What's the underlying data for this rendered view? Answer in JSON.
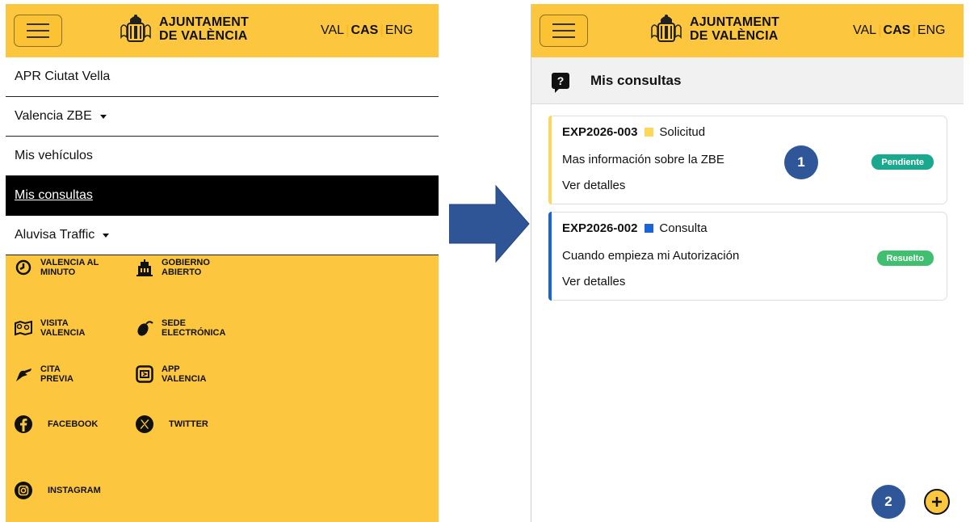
{
  "brand": {
    "line1": "AJUNTAMENT",
    "line2": "DE VALÈNCIA",
    "accent_color": "#fdc63f"
  },
  "languages": {
    "val": "VAL",
    "cas": "CAS",
    "eng": "ENG",
    "separator": "|",
    "selected": "CAS"
  },
  "menu": {
    "items": [
      {
        "label": "APR Ciutat Vella",
        "dropdown": false,
        "active": false
      },
      {
        "label": "Valencia ZBE",
        "dropdown": true,
        "active": false
      },
      {
        "label": "Mis vehículos",
        "dropdown": false,
        "active": false
      },
      {
        "label": "Mis consultas",
        "dropdown": false,
        "active": true
      },
      {
        "label": "Aluvisa Traffic",
        "dropdown": true,
        "active": false
      }
    ]
  },
  "footer_links": [
    {
      "label1": "VALENCIA AL",
      "label2": "MINUTO",
      "icon": "clock-icon"
    },
    {
      "label1": "GOBIERNO",
      "label2": "ABIERTO",
      "icon": "building-icon"
    },
    {
      "label1": "VISITA",
      "label2": "VALENCIA",
      "icon": "map-icon"
    },
    {
      "label1": "SEDE",
      "label2": "ELECTRÓNICA",
      "icon": "mouse-icon"
    },
    {
      "label1": "CITA",
      "label2": "PREVIA",
      "icon": "hand-icon"
    },
    {
      "label1": "APP",
      "label2": "VALENCIA",
      "icon": "app-icon"
    },
    {
      "label1": "FACEBOOK",
      "label2": "",
      "icon": "facebook-icon"
    },
    {
      "label1": "TWITTER",
      "label2": "",
      "icon": "x-twitter-icon"
    },
    {
      "label1": "INSTAGRAM",
      "label2": "",
      "icon": "instagram-icon"
    }
  ],
  "consultas": {
    "title": "Mis consultas",
    "icon": "question-bubble-icon",
    "cards": [
      {
        "code": "EXP2026-003",
        "type": "Solicitud",
        "type_color": "#fdd65a",
        "bar_color": "#fdd65a",
        "subject": "Mas información sobre la ZBE",
        "link": "Ver detalles",
        "status": "Pendiente",
        "status_color": "#1aa88e"
      },
      {
        "code": "EXP2026-002",
        "type": "Consulta",
        "type_color": "#1a63d8",
        "bar_color": "#1a63d8",
        "subject": "Cuando empieza mi Autorización",
        "link": "Ver detalles",
        "status": "Resuelto",
        "status_color": "#3fbf6f"
      }
    ],
    "add_button_icon": "plus-circle-icon"
  },
  "callouts": {
    "one": "1",
    "two": "2",
    "color": "#2e5698"
  }
}
